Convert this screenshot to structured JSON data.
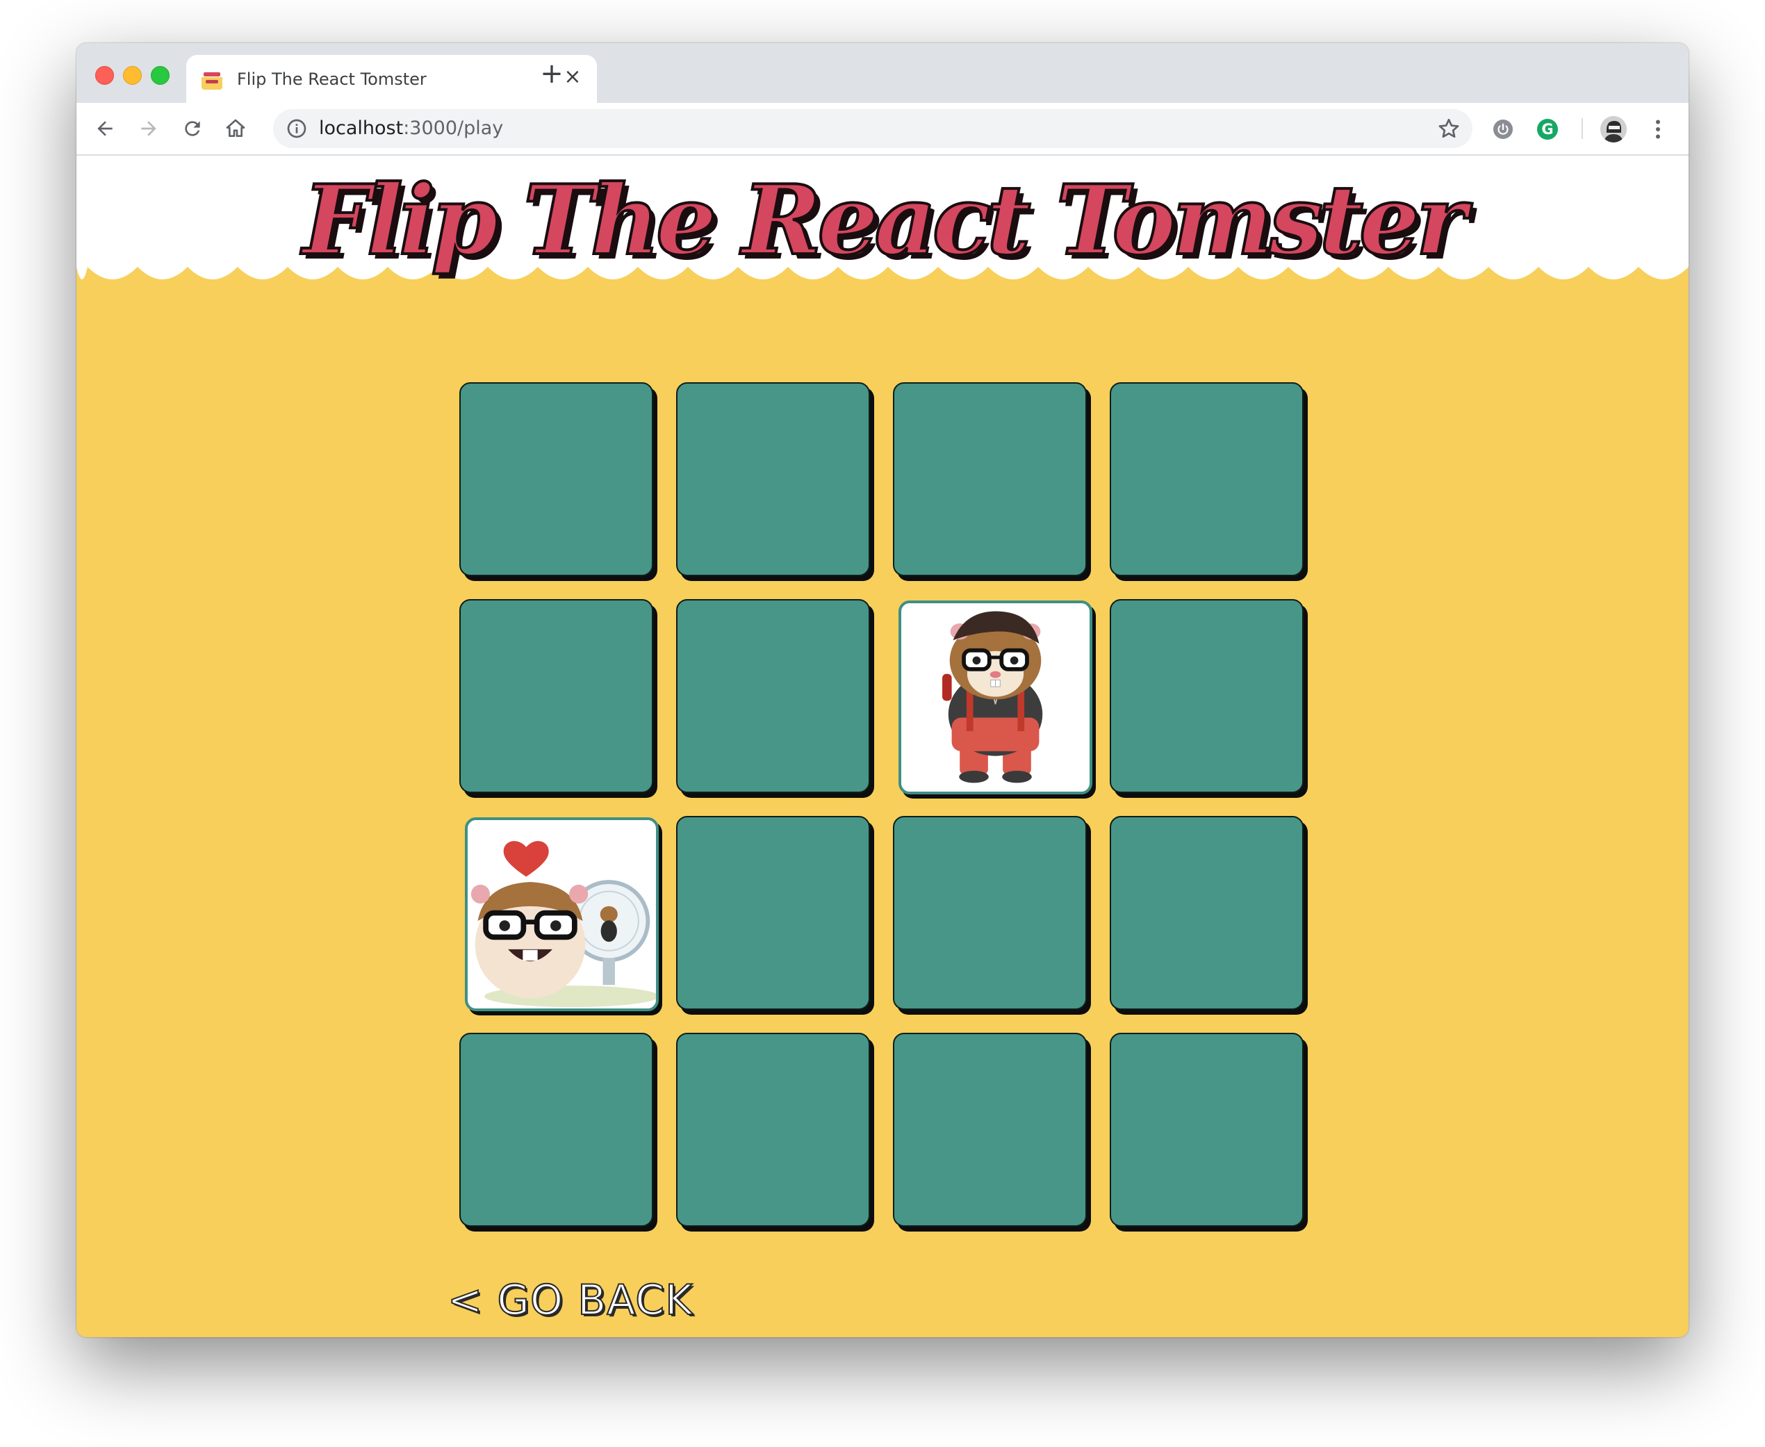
{
  "browser": {
    "tab_title": "Flip The React Tomster",
    "url_host": "localhost",
    "url_rest": ":3000/play",
    "icons": {
      "back": "arrow-left-icon",
      "forward": "arrow-right-icon",
      "reload": "reload-icon",
      "home": "home-icon",
      "info": "info-icon",
      "bookmark": "star-icon",
      "extension_1": "power-icon",
      "extension_2": "grammarly-icon",
      "menu": "kebab-menu-icon"
    },
    "extension_2_letter": "G"
  },
  "page": {
    "title": "Flip The React Tomster",
    "go_back_label": "< GO BACK"
  },
  "game": {
    "rows": 4,
    "columns": 4,
    "cards": [
      {
        "state": "face-down"
      },
      {
        "state": "face-down"
      },
      {
        "state": "face-down"
      },
      {
        "state": "face-down"
      },
      {
        "state": "face-down"
      },
      {
        "state": "face-down"
      },
      {
        "state": "face-up",
        "image": "hamster-standing-suspenders-picture"
      },
      {
        "state": "face-down"
      },
      {
        "state": "face-up",
        "image": "hamster-heart-wheel-picture"
      },
      {
        "state": "face-down"
      },
      {
        "state": "face-down"
      },
      {
        "state": "face-down"
      },
      {
        "state": "face-down"
      },
      {
        "state": "face-down"
      },
      {
        "state": "face-down"
      },
      {
        "state": "face-down"
      }
    ]
  },
  "colors": {
    "page_background": "#f7cf5a",
    "header_background": "#ffffff",
    "card_back": "#489688",
    "title_fill": "#d4475f",
    "title_outline": "#1a0d10"
  }
}
